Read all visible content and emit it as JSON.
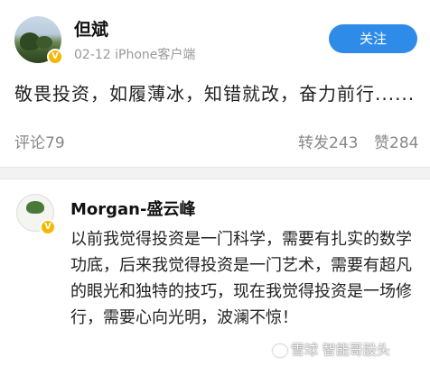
{
  "post1": {
    "author": "但斌",
    "meta": "02-12  iPhone客户端",
    "follow_label": "关注",
    "content": "敬畏投资，如履薄冰，知错就改，奋力前行......",
    "comment": "评论79",
    "forward": "转发243",
    "likes": "赞284",
    "verified_badge": "V"
  },
  "post2": {
    "author": "Morgan-盛云峰",
    "content": "以前我觉得投资是一门科学，需要有扎实的数学功底，后来我觉得投资是一门艺术，需要有超凡的眼光和独特的技巧，现在我觉得投资是一场修行，需要心向光明，波澜不惊！",
    "verified_badge": "V"
  },
  "watermark": "雪球  智能哥股头",
  "colors": {
    "follow_bg": "#2e8ce8",
    "badge": "#f5b700",
    "muted_text": "#888888",
    "separator": "#f2f2f2"
  },
  "icons": {
    "verified": "verified-badge-icon",
    "watermark": "xueqiu-logo-icon"
  }
}
